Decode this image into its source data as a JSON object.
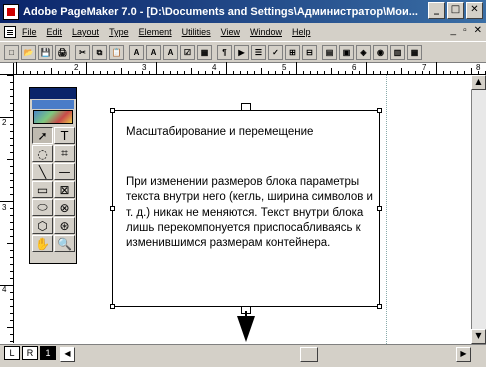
{
  "window": {
    "title": "Adobe PageMaker 7.0 - [D:\\Documents and Settings\\Администратор\\Мои...",
    "buttons": {
      "minimize": "_",
      "maximize": "□",
      "close": "✕"
    }
  },
  "menu": {
    "items": [
      "File",
      "Edit",
      "Layout",
      "Type",
      "Element",
      "Utilities",
      "View",
      "Window",
      "Help"
    ],
    "right_controls": [
      "_",
      "▫",
      "✕"
    ]
  },
  "toolbar": {
    "buttons": [
      "□",
      "📂",
      "💾",
      "🖨",
      "✂",
      "⧉",
      "📋",
      "A",
      "A",
      "A",
      "☑",
      "▦",
      "¶",
      "▶",
      "☰",
      "✓",
      "⊞",
      "⊟",
      "▤",
      "▣",
      "◈",
      "◉",
      "▥",
      "▦"
    ]
  },
  "ruler": {
    "top_labels": [
      "2",
      "3",
      "4",
      "5",
      "6",
      "7",
      "8"
    ],
    "left_labels": [
      "2",
      "3",
      "4"
    ]
  },
  "toolbox": {
    "tools": [
      {
        "name": "pointer-tool",
        "glyph": "➚"
      },
      {
        "name": "text-tool",
        "glyph": "T"
      },
      {
        "name": "rotate-tool",
        "glyph": "◌"
      },
      {
        "name": "crop-tool",
        "glyph": "⌗"
      },
      {
        "name": "line-tool",
        "glyph": "╲"
      },
      {
        "name": "constrained-line-tool",
        "glyph": "—"
      },
      {
        "name": "rectangle-tool",
        "glyph": "▭"
      },
      {
        "name": "rectangle-frame-tool",
        "glyph": "⊠"
      },
      {
        "name": "ellipse-tool",
        "glyph": "⬭"
      },
      {
        "name": "ellipse-frame-tool",
        "glyph": "⊗"
      },
      {
        "name": "polygon-tool",
        "glyph": "⬡"
      },
      {
        "name": "polygon-frame-tool",
        "glyph": "⊛"
      },
      {
        "name": "hand-tool",
        "glyph": "✋"
      },
      {
        "name": "zoom-tool",
        "glyph": "🔍"
      }
    ]
  },
  "text_block": {
    "heading": "Масштабирование и перемещение",
    "body": "При изменении размеров блока параметры текста внутри него (кегль, ширина символов и т. д.) никак не меняются. Текст внутри блока лишь перекомпонуется приспосабливаясь к изменившимся размерам контейнера."
  },
  "pages": {
    "tabs": [
      "L",
      "R",
      "1"
    ],
    "active": "1"
  }
}
